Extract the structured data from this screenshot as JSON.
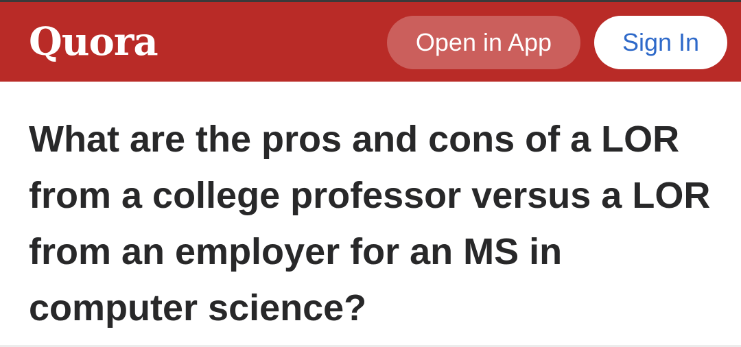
{
  "header": {
    "logo_text": "Quora",
    "open_in_app_label": "Open in App",
    "sign_in_label": "Sign In",
    "brand_color": "#b92b27"
  },
  "question": {
    "title": "What are the pros and cons of a LOR from a college professor versus a LOR from an employer for an MS in computer science?"
  }
}
